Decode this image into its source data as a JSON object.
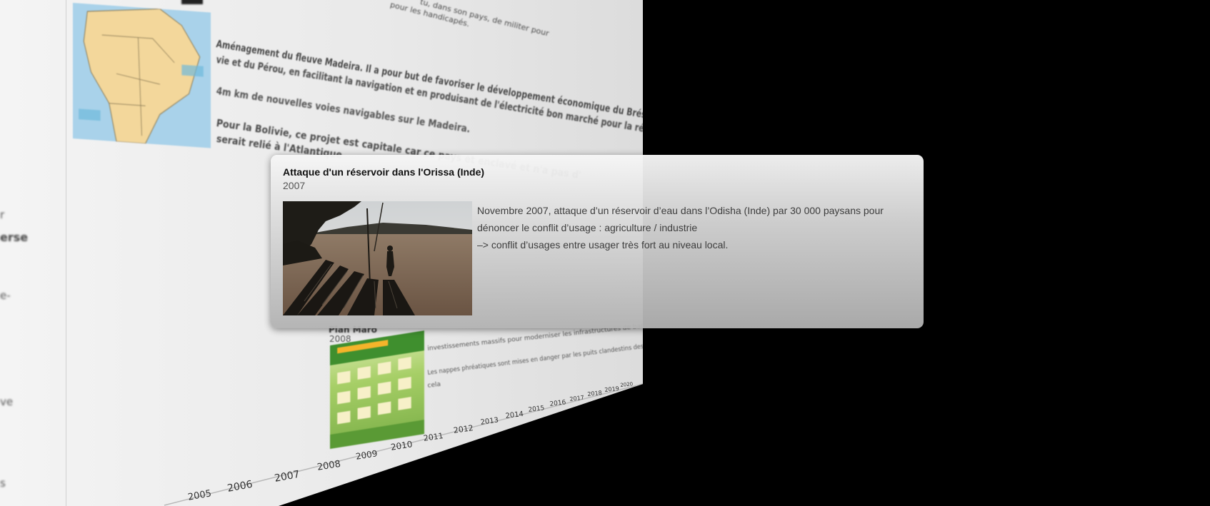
{
  "background_page": {
    "top_line_1": "tu, dans son pays, de militer pour",
    "top_line_2": "pour les handicapés.",
    "paragraph_1_line_1": "Aménagement du fleuve Madeira. Il a pour but de favoriser le développement économique du Brésil, de la Boli-",
    "paragraph_1_line_2": "vie et du Pérou, en facilitant la navigation et en produisant de l'électricité bon marché pour la région.",
    "paragraph_2": "4m km de nouvelles voies navigables sur le Madeira.",
    "paragraph_3_line_1": "Pour la Bolivie, ce projet est capitale car ce pays et enclavé et n'a pas d'",
    "paragraph_3_line_2": "serait relié à l'Atlantique",
    "left_fragments": [
      "r",
      "erse",
      "e-",
      "ve",
      "s"
    ],
    "flan_title": "Plan Maro",
    "flan_year": "2008",
    "flan_line_1": "investissements massifs pour moderniser les infrastructures de barrage",
    "flan_line_2": "Les nappes phréatiques sont mises en danger par les puits clandestins des petits agriculteurs. Il faut limiter",
    "flan_line_3": "cela",
    "timeline_years": [
      "2005",
      "2006",
      "2007",
      "2008",
      "2009",
      "2010",
      "2011",
      "2012",
      "2013",
      "2014",
      "2015",
      "2016",
      "2017",
      "2018",
      "2019",
      "2020"
    ]
  },
  "card": {
    "title": "Attaque d'un réservoir dans l'Orissa (Inde)",
    "year": "2007",
    "body_line_1": "Novembre 2007, attaque d’un réservoir d’eau dans l’Odisha (Inde) par 30 000 paysans pour",
    "body_line_2": "dénoncer le conflit d’usage : agriculture / industrie",
    "body_line_3": "–> conflit d’usages entre usager très fort au niveau local.",
    "photo_icon": "river-boats-photo"
  },
  "colors": {
    "background": "#000000",
    "page": "#ececec",
    "card_top": "#f6f6f6",
    "card_bottom": "#b2b2b2"
  }
}
